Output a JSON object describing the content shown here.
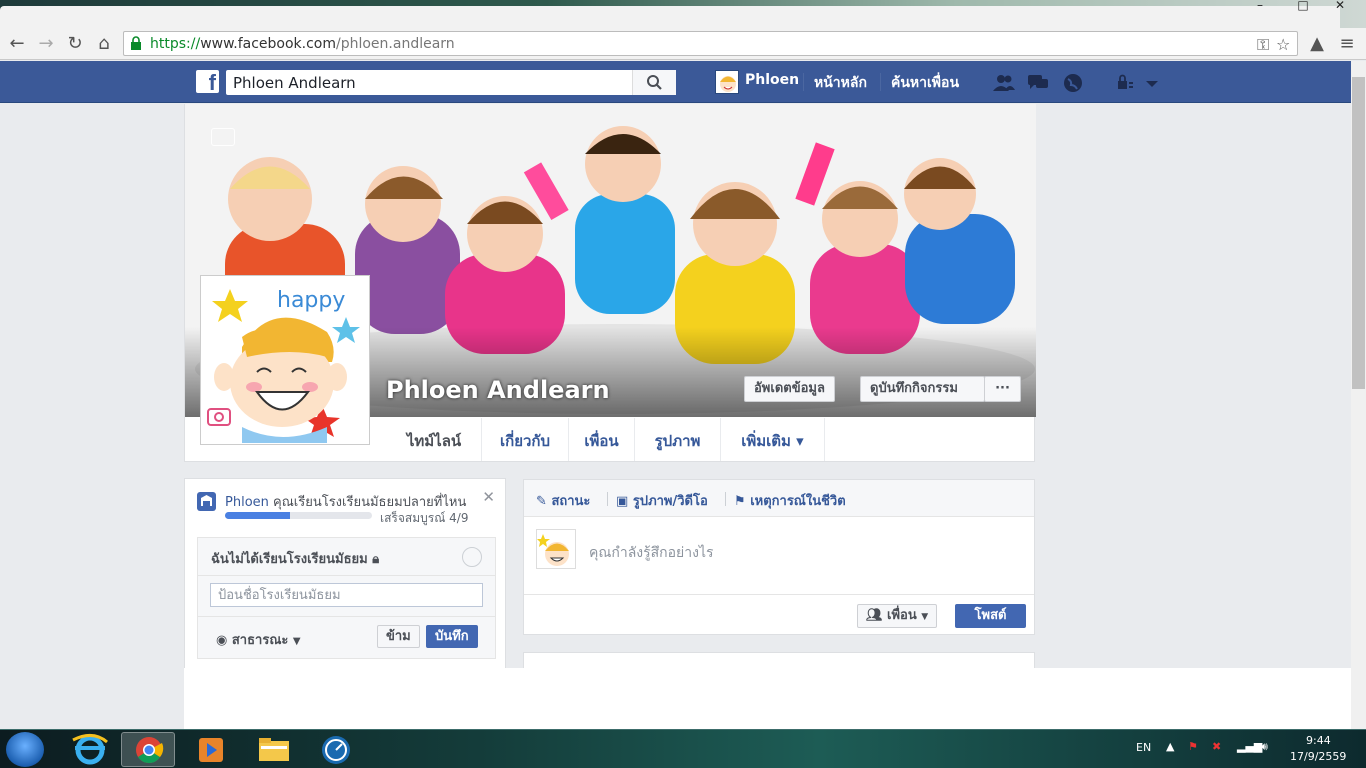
{
  "browser": {
    "url_scheme": "https://",
    "url_host": "www.facebook.com",
    "url_path": "/phloen.andlearn",
    "window_controls": [
      "–",
      "□",
      "✕"
    ]
  },
  "fb_header": {
    "logo": "f",
    "search_value": "Phloen Andlearn",
    "profile_name": "Phloen",
    "home_label": "หน้าหลัก",
    "find_friends_label": "ค้นหาเพื่อน"
  },
  "profile": {
    "name": "Phloen Andlearn",
    "update_info_label": "อัพเดตข้อมูล",
    "activity_log_label": "ดูบันทึกกิจกรรม",
    "more_label": "···",
    "tabs": [
      {
        "label": "ไทม์ไลน์"
      },
      {
        "label": "เกี่ยวกับ"
      },
      {
        "label": "เพื่อน"
      },
      {
        "label": "รูปภาพ"
      },
      {
        "label": "เพิ่มเติม ▾"
      }
    ]
  },
  "school_card": {
    "question_name": "Phloen",
    "question_text": "คุณเรียนโรงเรียนมัธยมปลายที่ไหน",
    "progress_text": "เสร็จสมบูรณ์ 4/9",
    "progress_fraction": 0.44,
    "no_school_label": "ฉันไม่ได้เรียนโรงเรียนมัธยม",
    "input_placeholder": "ป้อนชื่อโรงเรียนมัธยม",
    "privacy_label": "สาธารณะ",
    "skip_label": "ข้าม",
    "save_label": "บันทึก"
  },
  "composer": {
    "tab_status": "สถานะ",
    "tab_photo": "รูปภาพ/วิดีโอ",
    "tab_life_event": "เหตุการณ์ในชีวิต",
    "placeholder": "คุณกำลังรู้สึกอย่างไร",
    "audience_label": "เพื่อน",
    "post_label": "โพสต์"
  },
  "avatar_text": "happy",
  "taskbar": {
    "language": "EN",
    "time": "9:44",
    "date": "17/9/2559"
  },
  "colors": {
    "fb_blue": "#3b5998",
    "button_blue": "#4267b2",
    "link_blue": "#365899"
  }
}
